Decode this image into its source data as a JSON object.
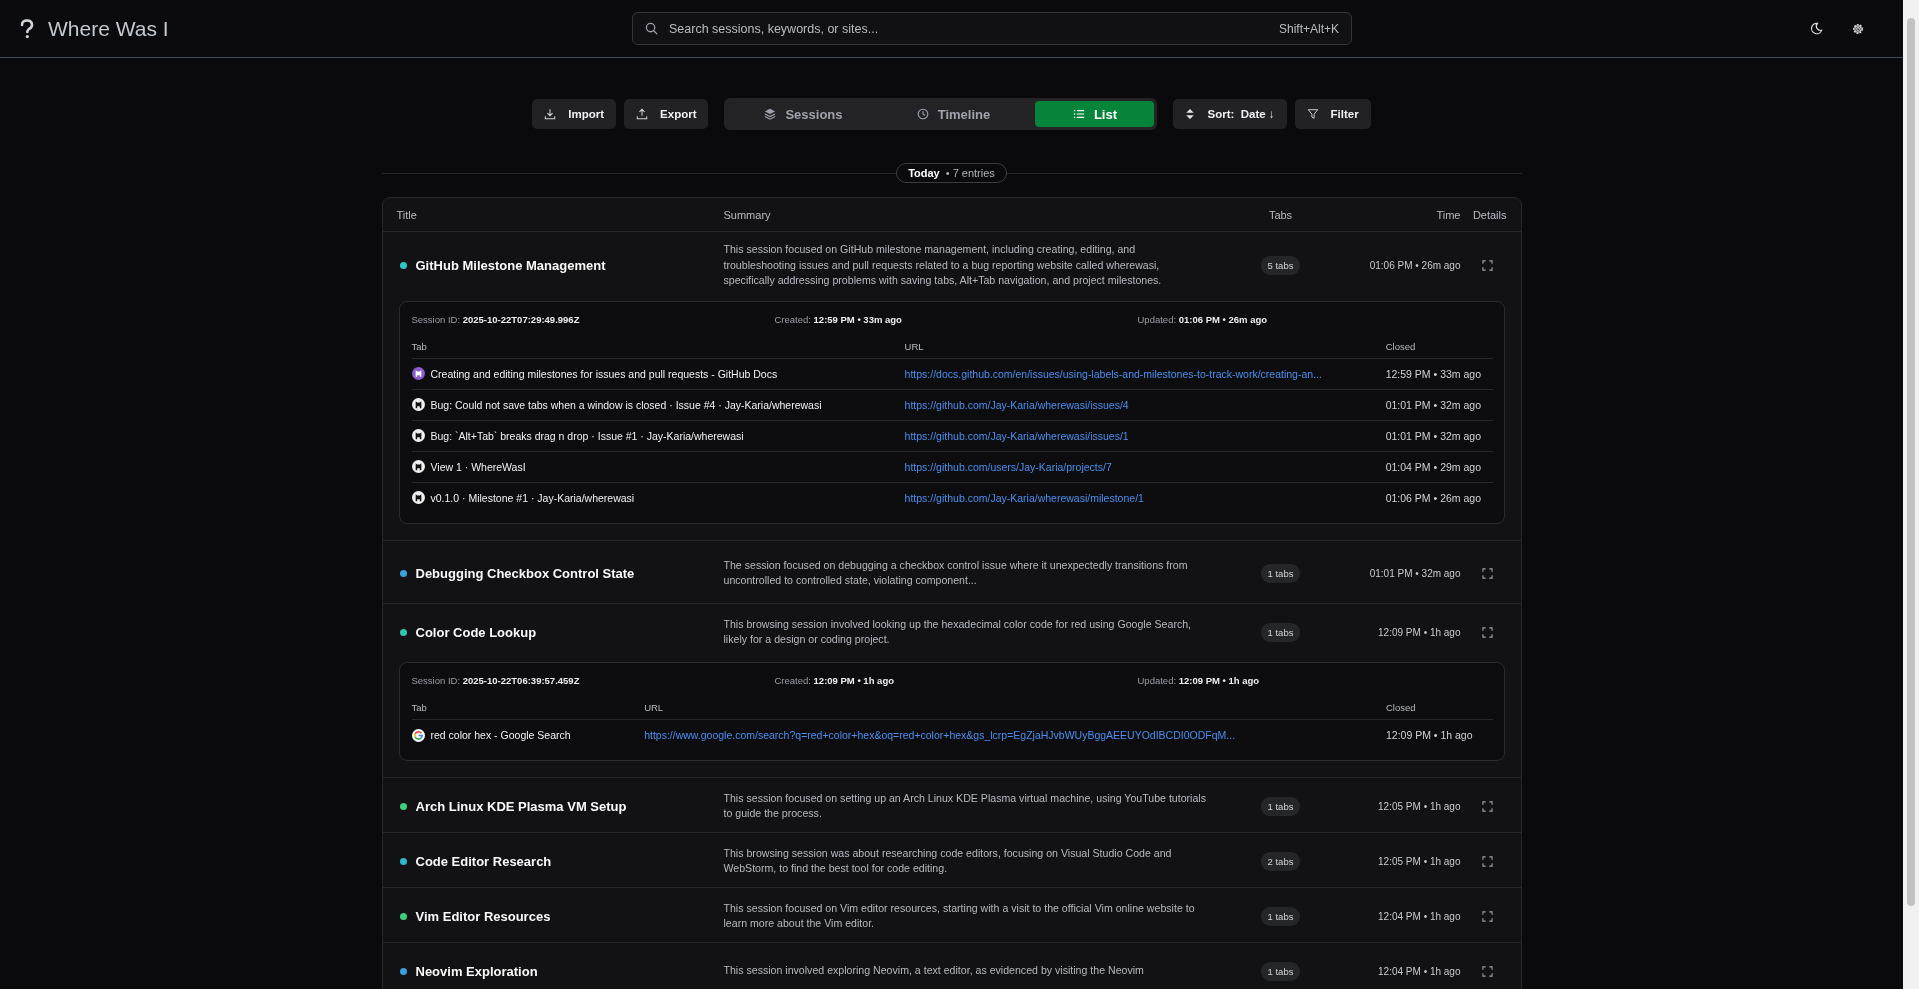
{
  "header": {
    "title": "Where Was I",
    "search": {
      "placeholder": "Search sessions, keywords, or sites...",
      "shortcut": "Shift+Alt+K"
    }
  },
  "toolbar": {
    "buttons": [
      {
        "label": "Import",
        "kind": "import"
      },
      {
        "label": "Export",
        "kind": "export"
      }
    ],
    "views": [
      {
        "label": "Sessions",
        "kind": "sessions",
        "selected": false
      },
      {
        "label": "Timeline",
        "kind": "timeline",
        "selected": false
      },
      {
        "label": "List",
        "kind": "list",
        "selected": true
      }
    ],
    "sort": {
      "label": "Sort:",
      "value": "Date ↓"
    },
    "filter": {
      "label": "Filter"
    }
  },
  "group": {
    "label": "Today",
    "count": "• 7 entries"
  },
  "table": {
    "columns": [
      "Title",
      "Summary",
      "Tabs",
      "Time",
      "Details"
    ],
    "sessions": [
      {
        "title": "GitHub Milestone Management",
        "color": "#2ec4c4",
        "summary": "This session focused on GitHub milestone management, including creating, editing, and troubleshooting issues and pull requests related to a bug reporting website called wherewasi, specifically addressing problems with saving tabs, Alt+Tab navigation, and project milestones.",
        "tabs": "5 tabs",
        "time": "01:06 PM • 26m ago",
        "expanded": true,
        "details": {
          "id_label": "Session ID:",
          "id": "2025-10-22T07:29:49.996Z",
          "created_label": "Created:",
          "created": "12:59 PM • 33m ago",
          "updated_label": "Updated:",
          "updated": "01:06 PM • 26m ago",
          "columns": [
            "Tab",
            "URL",
            "Closed"
          ],
          "tabs": [
            {
              "kind": "github-docs",
              "title": "Creating and editing milestones for issues and pull requests - GitHub Docs",
              "url": "https://docs.github.com/en/issues/using-labels-and-milestones-to-track-work/creating-an...",
              "closed": "12:59 PM • 33m ago"
            },
            {
              "kind": "github",
              "title": "Bug: Could not save tabs when a window is closed · Issue #4 · Jay-Karia/wherewasi",
              "url": "https://github.com/Jay-Karia/wherewasi/issues/4",
              "closed": "01:01 PM • 32m ago"
            },
            {
              "kind": "github",
              "title": "Bug: `Alt+Tab` breaks drag n drop · Issue #1 · Jay-Karia/wherewasi",
              "url": "https://github.com/Jay-Karia/wherewasi/issues/1",
              "closed": "01:01 PM • 32m ago"
            },
            {
              "kind": "github",
              "title": "View 1 · WhereWasI",
              "url": "https://github.com/users/Jay-Karia/projects/7",
              "closed": "01:04 PM • 29m ago"
            },
            {
              "kind": "github",
              "title": "v0.1.0 · Milestone #1 · Jay-Karia/wherewasi",
              "url": "https://github.com/Jay-Karia/wherewasi/milestone/1",
              "closed": "01:06 PM • 26m ago"
            }
          ]
        }
      },
      {
        "title": "Debugging Checkbox Control State",
        "color": "#3ba4dc",
        "summary": "The session focused on debugging a checkbox control issue where it unexpectedly transitions from uncontrolled to controlled state, violating component...",
        "tabs": "1 tabs",
        "time": "01:01 PM • 32m ago",
        "expanded": false
      },
      {
        "title": "Color Code Lookup",
        "color": "#2ec4b0",
        "summary": "This browsing session involved looking up the hexadecimal color code for red using Google Search, likely for a design or coding project.",
        "tabs": "1 tabs",
        "time": "12:09 PM • 1h ago",
        "expanded": true,
        "details": {
          "id_label": "Session ID:",
          "id": "2025-10-22T06:39:57.459Z",
          "created_label": "Created:",
          "created": "12:09 PM • 1h ago",
          "updated_label": "Updated:",
          "updated": "12:09 PM • 1h ago",
          "columns": [
            "Tab",
            "URL",
            "Closed"
          ],
          "tabs": [
            {
              "kind": "google",
              "title": "red color hex - Google Search",
              "url": "https://www.google.com/search?q=red+color+hex&oq=red+color+hex&gs_lcrp=EgZjaHJvbWUyBggAEEUYOdIBCDI0ODFqM...",
              "closed": "12:09 PM • 1h ago"
            }
          ]
        }
      },
      {
        "title": "Arch Linux KDE Plasma VM Setup",
        "color": "#3ecf7a",
        "summary": "This session focused on setting up an Arch Linux KDE Plasma virtual machine, using YouTube tutorials to guide the process.",
        "tabs": "1 tabs",
        "time": "12:05 PM • 1h ago",
        "expanded": false
      },
      {
        "title": "Code Editor Research",
        "color": "#2eb8cc",
        "summary": "This browsing session was about researching code editors, focusing on Visual Studio Code and WebStorm, to find the best tool for code editing.",
        "tabs": "2 tabs",
        "time": "12:05 PM • 1h ago",
        "expanded": false
      },
      {
        "title": "Vim Editor Resources",
        "color": "#3ecf7a",
        "summary": "This session focused on Vim editor resources, starting with a visit to the official Vim online website to learn more about the Vim editor.",
        "tabs": "1 tabs",
        "time": "12:04 PM • 1h ago",
        "expanded": false
      },
      {
        "title": "Neovim Exploration",
        "color": "#3b9ee0",
        "summary": "This session involved exploring Neovim, a text editor, as evidenced by visiting the Neovim",
        "tabs": "1 tabs",
        "time": "12:04 PM • 1h ago",
        "expanded": false
      }
    ]
  }
}
